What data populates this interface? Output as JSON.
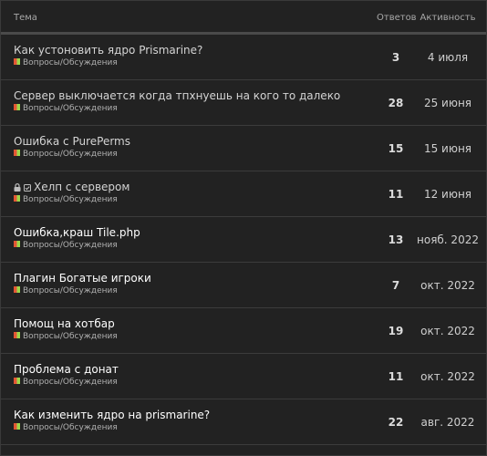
{
  "header": {
    "topic": "Тема",
    "replies": "Ответов",
    "activity": "Активность"
  },
  "category_color": "#e45735",
  "category_color_2": "#9bd84c",
  "topics": [
    {
      "title": "Как устоновить ядро Prismarine?",
      "category": "Вопросы/Обсуждения",
      "replies": "3",
      "activity": "4 июля",
      "unread": false,
      "closed": false
    },
    {
      "title": "Сервер выключается когда тпхнуешь на кого то далеко",
      "category": "Вопросы/Обсуждения",
      "replies": "28",
      "activity": "25 июня",
      "unread": false,
      "closed": false
    },
    {
      "title": "Ошибка с PurePerms",
      "category": "Вопросы/Обсуждения",
      "replies": "15",
      "activity": "15 июня",
      "unread": false,
      "closed": false
    },
    {
      "title": "Хелп с сервером",
      "category": "Вопросы/Обсуждения",
      "replies": "11",
      "activity": "12 июня",
      "unread": false,
      "closed": true,
      "icons": [
        "lock-icon",
        "check-icon"
      ]
    },
    {
      "title": "Ошибка,краш Tile.php",
      "category": "Вопросы/Обсуждения",
      "replies": "13",
      "activity": "нояб. 2022",
      "unread": true,
      "closed": false
    },
    {
      "title": "Плагин Богатые игроки",
      "category": "Вопросы/Обсуждения",
      "replies": "7",
      "activity": "окт. 2022",
      "unread": true,
      "closed": false
    },
    {
      "title": "Помощ на хотбар",
      "category": "Вопросы/Обсуждения",
      "replies": "19",
      "activity": "окт. 2022",
      "unread": true,
      "closed": false
    },
    {
      "title": "Проблема с донат",
      "category": "Вопросы/Обсуждения",
      "replies": "11",
      "activity": "окт. 2022",
      "unread": true,
      "closed": false
    },
    {
      "title": "Как изменить ядро на prismarine?",
      "category": "Вопросы/Обсуждения",
      "replies": "22",
      "activity": "авг. 2022",
      "unread": true,
      "closed": false
    }
  ]
}
